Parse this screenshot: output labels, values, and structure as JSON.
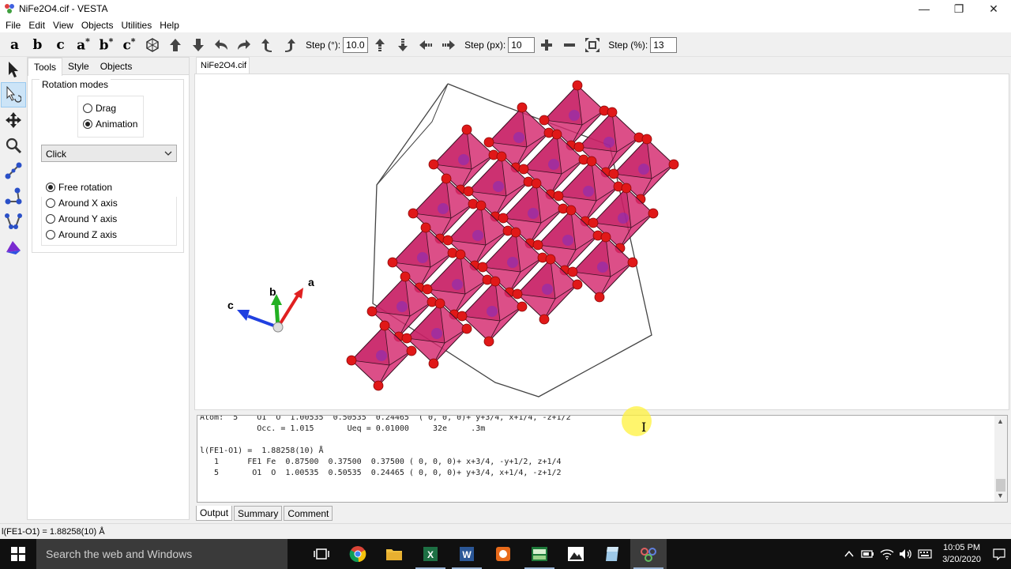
{
  "window": {
    "title": "NiFe2O4.cif - VESTA",
    "minimize": "—",
    "restore": "❐",
    "close": "✕"
  },
  "menu": [
    "File",
    "Edit",
    "View",
    "Objects",
    "Utilities",
    "Help"
  ],
  "toolbar": {
    "axes": [
      {
        "base": "a",
        "sup": ""
      },
      {
        "base": "b",
        "sup": ""
      },
      {
        "base": "c",
        "sup": ""
      },
      {
        "base": "a",
        "sup": "*"
      },
      {
        "base": "b",
        "sup": "*"
      },
      {
        "base": "c",
        "sup": "*"
      }
    ],
    "step_deg_label": "Step (°):",
    "step_deg_value": "10.0",
    "step_px_label": "Step (px):",
    "step_px_value": "10",
    "step_pct_label": "Step (%):",
    "step_pct_value": "13"
  },
  "side_panel": {
    "tabs": [
      "Tools",
      "Style",
      "Objects"
    ],
    "rotation_modes_label": "Rotation modes",
    "drag_label": "Drag",
    "animation_label": "Animation",
    "selected_mode": "Animation",
    "click_select_value": "Click",
    "axis_options": [
      "Free rotation",
      "Around X axis",
      "Around Y axis",
      "Around Z axis"
    ],
    "selected_axis": "Free rotation"
  },
  "document_tab": "NiFe2O4.cif",
  "axes_indicator": {
    "a": "a",
    "b": "b",
    "c": "c"
  },
  "output": {
    "lines": [
      "Atom:  5    O1  O  1.00535  0.50535  0.24465  ( 0, 0, 0)+ y+3/4, x+1/4, -z+1/2",
      "            Occ. = 1.015       Ueq = 0.01000     32e     .3m",
      "",
      "l(FE1-O1) =  1.88258(10) Å",
      "   1      FE1 Fe  0.87500  0.37500  0.37500 ( 0, 0, 0)+ x+3/4, -y+1/2, z+1/4",
      "   5       O1  O  1.00535  0.50535  0.24465 ( 0, 0, 0)+ y+3/4, x+1/4, -z+1/2"
    ],
    "tabs": [
      "Output",
      "Summary",
      "Comment"
    ],
    "active_tab": "Output"
  },
  "status_text": "l(FE1-O1) = 1.88258(10) Å",
  "taskbar": {
    "search_placeholder": "Search the web and Windows",
    "time": "10:05 PM",
    "date": "3/20/2020"
  },
  "colors": {
    "octahedron": "#d4286e",
    "oxygen": "#e01818",
    "axis_a": "#e02020",
    "axis_b": "#22b022",
    "axis_c": "#2040e0"
  }
}
